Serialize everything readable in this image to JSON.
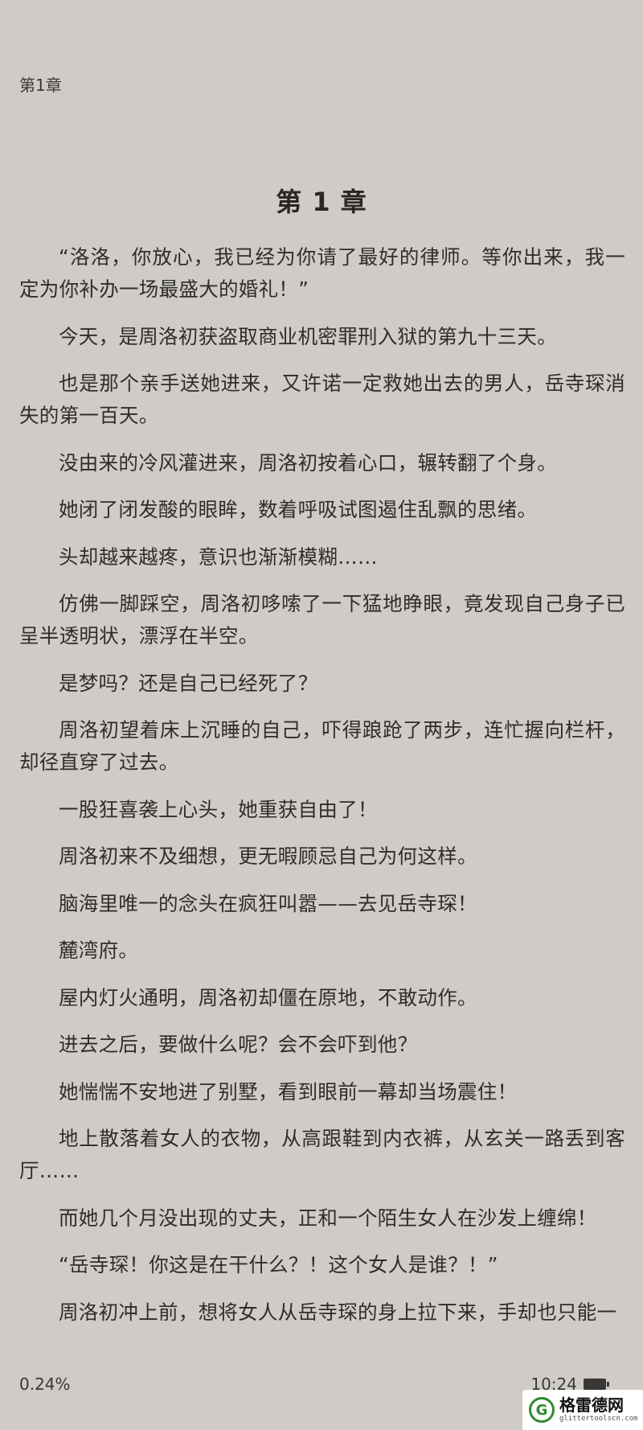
{
  "header": {
    "chapter_label": "第1章"
  },
  "chapter": {
    "title": "第 1 章"
  },
  "paragraphs": [
    "“洛洛，你放心，我已经为你请了最好的律师。等你出来，我一定为你补办一场最盛大的婚礼！”",
    "今天，是周洛初获盗取商业机密罪刑入狱的第九十三天。",
    "也是那个亲手送她进来，又许诺一定救她出去的男人，岳寺琛消失的第一百天。",
    "没由来的冷风灌进来，周洛初按着心口，辗转翻了个身。",
    "她闭了闭发酸的眼眸，数着呼吸试图遏住乱飘的思绪。",
    "头却越来越疼，意识也渐渐模糊……",
    "仿佛一脚踩空，周洛初哆嗦了一下猛地睁眼，竟发现自己身子已呈半透明状，漂浮在半空。",
    "是梦吗？还是自己已经死了？",
    "周洛初望着床上沉睡的自己，吓得踉跄了两步，连忙握向栏杆，却径直穿了过去。",
    "一股狂喜袭上心头，她重获自由了！",
    "周洛初来不及细想，更无暇顾忌自己为何这样。",
    "脑海里唯一的念头在疯狂叫嚣——去见岳寺琛！",
    "麓湾府。",
    "屋内灯火通明，周洛初却僵在原地，不敢动作。",
    "进去之后，要做什么呢？会不会吓到他？",
    "她惴惴不安地进了别墅，看到眼前一幕却当场震住！",
    "地上散落着女人的衣物，从高跟鞋到内衣裤，从玄关一路丢到客厅……",
    "而她几个月没出现的丈夫，正和一个陌生女人在沙发上缠绵！",
    "“岳寺琛！你这是在干什么？！这个女人是谁？！”",
    "周洛初冲上前，想将女人从岳寺琛的身上拉下来，手却也只能一"
  ],
  "footer": {
    "progress": "0.24%",
    "time": "10:24",
    "battery_icon": "battery-icon"
  },
  "watermark": {
    "logo_letter": "G",
    "name": "格雷德网",
    "url": "glittertoolscn.com"
  },
  "colors": {
    "background": "#cfccc7",
    "text": "#2f2d2b",
    "watermark_green": "#2e8b2e"
  }
}
